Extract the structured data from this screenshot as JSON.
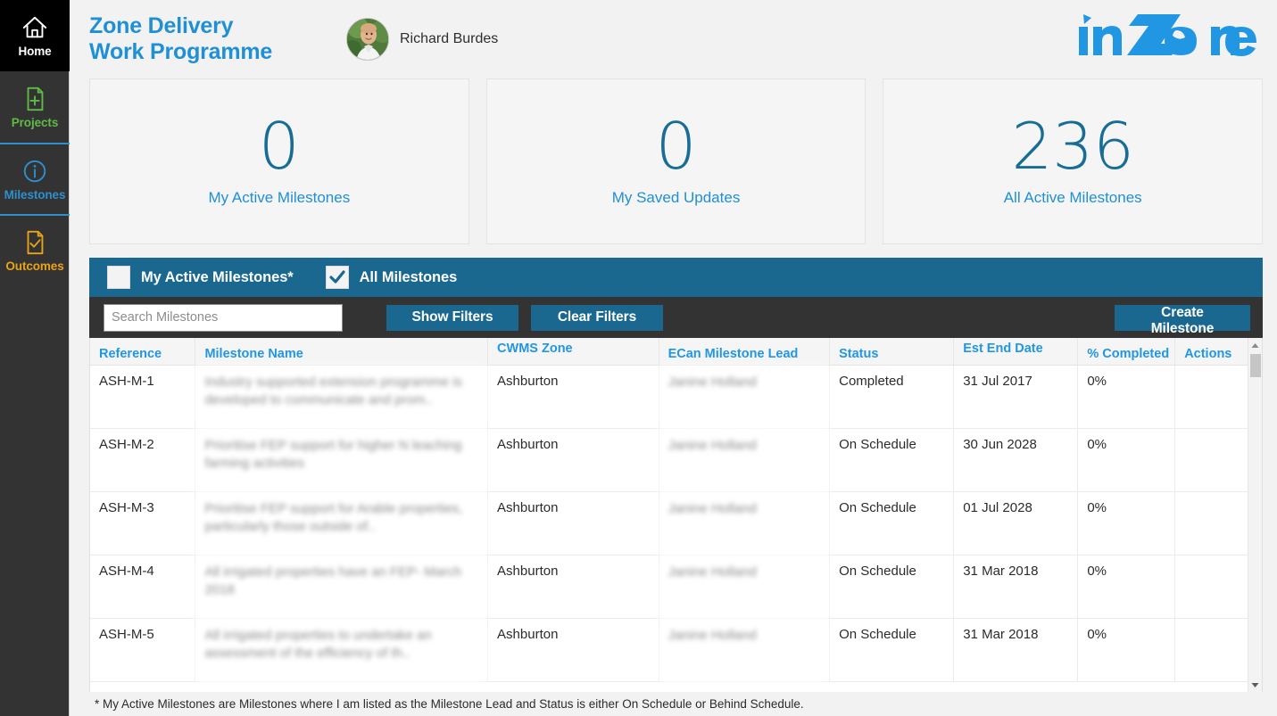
{
  "sidebar": {
    "items": [
      {
        "label": "Home",
        "icon": "home-icon",
        "color": "#ffffff",
        "active": true
      },
      {
        "label": "Projects",
        "icon": "file-plus-icon",
        "color": "#5fbb46",
        "active": false
      },
      {
        "label": "Milestones",
        "icon": "info-circle-icon",
        "color": "#2f8fce",
        "active": false
      },
      {
        "label": "Outcomes",
        "icon": "file-check-icon",
        "color": "#e8a317",
        "active": false
      }
    ]
  },
  "header": {
    "title": "Zone Delivery\nWork Programme",
    "user_name": "Richard Burdes",
    "avatar": "user-photo",
    "logo_text": "inZone",
    "title_color": "#1f8fd6",
    "logo_color": "#2196e3"
  },
  "cards": [
    {
      "value": "0",
      "label": "My Active Milestones"
    },
    {
      "value": "0",
      "label": "My Saved Updates"
    },
    {
      "value": "236",
      "label": "All Active Milestones"
    }
  ],
  "toolbar": {
    "checkboxes": [
      {
        "label": "My Active Milestones*",
        "checked": false
      },
      {
        "label": "All Milestones",
        "checked": true
      }
    ],
    "search_placeholder": "Search Milestones",
    "search_value": "",
    "show_filters_label": "Show Filters",
    "clear_filters_label": "Clear Filters",
    "create_milestone_label": "Create Milestone",
    "bar_color": "#1a688f",
    "strip_color": "#333333"
  },
  "table": {
    "columns": [
      {
        "key": "reference",
        "label": "Reference"
      },
      {
        "key": "name",
        "label": "Milestone Name"
      },
      {
        "key": "zone",
        "label": "CWMS Zone"
      },
      {
        "key": "lead",
        "label": "ECan Milestone Lead"
      },
      {
        "key": "status",
        "label": "Status"
      },
      {
        "key": "est_end",
        "label": "Est End Date"
      },
      {
        "key": "completed",
        "label": "% Completed"
      },
      {
        "key": "actions",
        "label": "Actions"
      }
    ],
    "rows": [
      {
        "reference": "ASH-M-1",
        "name": "Industry supported extension programme is developed to communicate and prom..",
        "zone": "Ashburton",
        "lead": "Janine Holland",
        "status": "Completed",
        "est_end": "31 Jul 2017",
        "completed": "0%",
        "actions": ""
      },
      {
        "reference": "ASH-M-2",
        "name": "Prioritise FEP support for higher N leaching farming activities",
        "zone": "Ashburton",
        "lead": "Janine Holland",
        "status": "On Schedule",
        "est_end": "30 Jun 2028",
        "completed": "0%",
        "actions": ""
      },
      {
        "reference": "ASH-M-3",
        "name": "Prioritise FEP support for Arable properties, particularly those outside of..",
        "zone": "Ashburton",
        "lead": "Janine Holland",
        "status": "On Schedule",
        "est_end": "01 Jul 2028",
        "completed": "0%",
        "actions": ""
      },
      {
        "reference": "ASH-M-4",
        "name": "All irrigated properties have an FEP- March 2018",
        "zone": "Ashburton",
        "lead": "Janine Holland",
        "status": "On Schedule",
        "est_end": "31 Mar 2018",
        "completed": "0%",
        "actions": ""
      },
      {
        "reference": "ASH-M-5",
        "name": "All irrigated properties to undertake an assessment of the efficiency of th..",
        "zone": "Ashburton",
        "lead": "Janine Holland",
        "status": "On Schedule",
        "est_end": "31 Mar 2018",
        "completed": "0%",
        "actions": ""
      }
    ]
  },
  "footnote": "* My Active Milestones are Milestones where I am listed as the Milestone Lead and Status is either On Schedule or Behind Schedule."
}
